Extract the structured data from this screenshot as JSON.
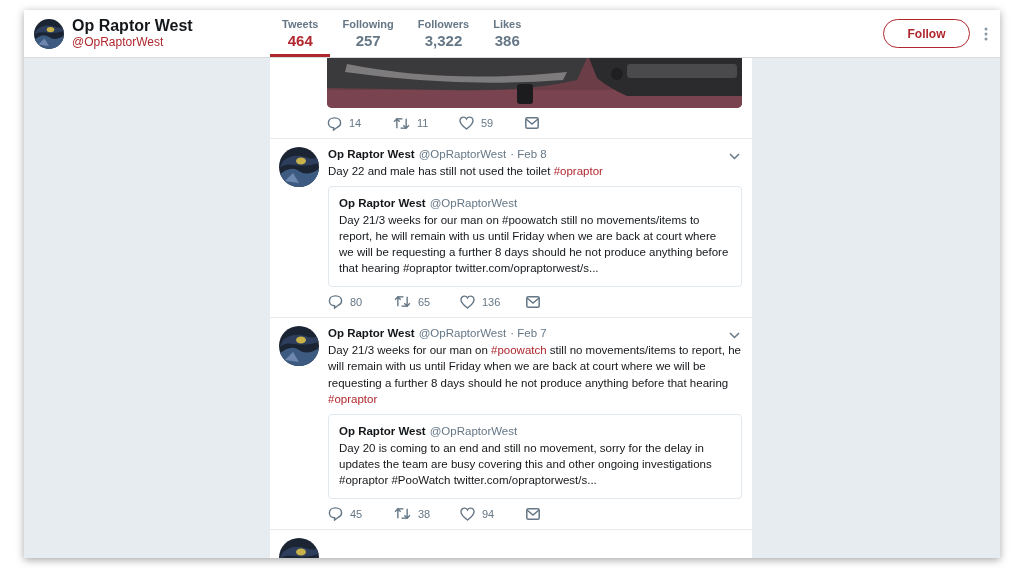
{
  "profile": {
    "name": "Op Raptor West",
    "handle": "@OpRaptorWest"
  },
  "stats": [
    {
      "label": "Tweets",
      "value": "464",
      "selected": true
    },
    {
      "label": "Following",
      "value": "257",
      "selected": false
    },
    {
      "label": "Followers",
      "value": "3,322",
      "selected": false
    },
    {
      "label": "Likes",
      "value": "386",
      "selected": false
    }
  ],
  "follow_button": "Follow",
  "tweets": [
    {
      "kind": "media_end",
      "actions": {
        "replies": "14",
        "retweets": "11",
        "likes": "59"
      }
    },
    {
      "kind": "tweet",
      "name": "Op Raptor West",
      "handle": "@OpRaptorWest",
      "date": "· Feb 8",
      "text": [
        {
          "kind": "plain",
          "text": "Day 22 and male has still not used the toilet "
        },
        {
          "kind": "hashtag",
          "text": "#opraptor"
        }
      ],
      "quote": {
        "name": "Op Raptor West",
        "handle": "@OpRaptorWest",
        "text": "Day 21/3 weeks for our man on #poowatch still no movements/items to report, he will remain with us until Friday when we are back at court where we will be requesting a further 8 days should he not produce anything before that hearing #opraptor twitter.com/opraptorwest/s..."
      },
      "actions": {
        "replies": "80",
        "retweets": "65",
        "likes": "136"
      }
    },
    {
      "kind": "tweet",
      "name": "Op Raptor West",
      "handle": "@OpRaptorWest",
      "date": "· Feb 7",
      "text": [
        {
          "kind": "plain",
          "text": "Day 21/3 weeks for our man on "
        },
        {
          "kind": "hashtag",
          "text": "#poowatch"
        },
        {
          "kind": "plain",
          "text": " still no movements/items to report, he will remain with us until Friday when we are back at court where we will be requesting a further 8 days should he not produce anything before that hearing "
        },
        {
          "kind": "hashtag",
          "text": "#opraptor"
        }
      ],
      "quote": {
        "name": "Op Raptor West",
        "handle": "@OpRaptorWest",
        "text": "Day 20 is coming to an end and still no movement, sorry for the delay in updates the team are busy covering this and other ongoing investigations #opraptor #PooWatch twitter.com/opraptorwest/s..."
      },
      "actions": {
        "replies": "45",
        "retweets": "38",
        "likes": "94"
      }
    },
    {
      "kind": "partial"
    }
  ]
}
